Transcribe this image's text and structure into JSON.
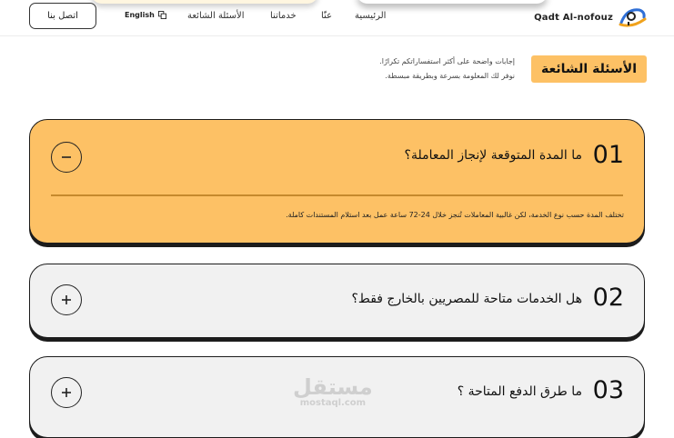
{
  "header": {
    "logo_text": "Qadt Al-nofouz",
    "nav": {
      "home": "الرئيسية",
      "about": "عنّا",
      "services": "خدماتنا",
      "faq": "الأسئلة الشائعة"
    },
    "language_label": "English",
    "contact_label": "اتصل بنا"
  },
  "faq_section": {
    "title": "الأسئلة الشائعة",
    "intro_line_1": "إجابات واضحة على أكثر استفساراتكم تكرارًا.",
    "intro_line_2": "نوفر لك المعلومة بسرعة وبطريقة مبسطة."
  },
  "faqs": [
    {
      "number": "01",
      "question": "ما المدة المتوقعة لإنجاز المعاملة؟",
      "answer": "تختلف المدة حسب نوع الخدمة، لكن غالبية المعاملات تُنجز خلال 24-72 ساعة عمل بعد استلام المستندات كاملة.",
      "expanded": true,
      "toggle_icon": "minus-icon"
    },
    {
      "number": "02",
      "question": "هل الخدمات متاحة للمصريين بالخارج فقط؟",
      "expanded": false,
      "toggle_icon": "plus-icon"
    },
    {
      "number": "03",
      "question": "ما طرق الدفع المتاحة ؟",
      "expanded": false,
      "toggle_icon": "plus-icon"
    }
  ],
  "watermark": {
    "arabic": "مستقل",
    "latin": "mostaql.com"
  },
  "colors": {
    "accent": "#fdc165",
    "card_background": "#f1f1f1",
    "border": "#1c1c1c",
    "logo_blue": "#2f6fd6",
    "logo_orange": "#f0a21c"
  }
}
